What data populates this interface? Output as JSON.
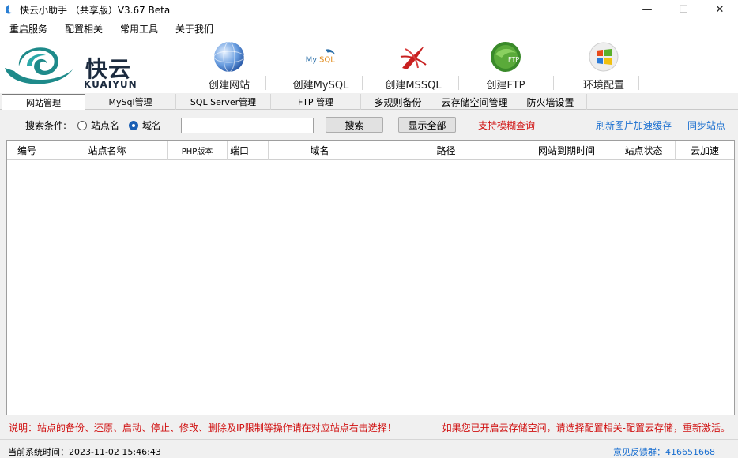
{
  "window": {
    "title": "快云小助手 （共享版）V3.67 Beta",
    "minimize_glyph": "—",
    "maximize_glyph": "☐",
    "close_glyph": "✕"
  },
  "menu": [
    "重启服务",
    "配置相关",
    "常用工具",
    "关于我们"
  ],
  "logo": {
    "cn": "快云",
    "en": "KUAIYUN"
  },
  "toolbar": [
    {
      "label": "创建网站",
      "icon": "globe-icon"
    },
    {
      "label": "创建MySQL",
      "icon": "mysql-icon"
    },
    {
      "label": "创建MSSQL",
      "icon": "mssql-icon"
    },
    {
      "label": "创建FTP",
      "icon": "ftp-icon"
    },
    {
      "label": "环境配置",
      "icon": "windows-icon"
    }
  ],
  "tabs": [
    "网站管理",
    "MySql管理",
    "SQL Server管理",
    "FTP 管理",
    "多规则备份",
    "云存储空间管理",
    "防火墙设置"
  ],
  "search": {
    "condition_label": "搜索条件:",
    "option_site": "站点名",
    "option_domain": "域名",
    "selected": "域名",
    "value": "",
    "search_button": "搜索",
    "show_all_button": "显示全部",
    "fuzzy_hint": "支持模糊查询",
    "refresh_link": "刷新图片加速缓存",
    "sync_link": "同步站点"
  },
  "table": {
    "columns": [
      "编号",
      "站点名称",
      "PHP版本",
      "端口",
      "域名",
      "路径",
      "网站到期时间",
      "站点状态",
      "云加速"
    ],
    "rows": []
  },
  "notes": {
    "left": "说明：站点的备份、还原、启动、停止、修改、删除及IP限制等操作请在对应站点右击选择！",
    "right": "如果您已开启云存储空间，请选择配置相关-配置云存储，重新激活。"
  },
  "status": {
    "time_label": "当前系统时间：",
    "time_value": "2023-11-02 15:46:43",
    "feedback_link": "意见反馈群：416651668"
  },
  "colors": {
    "accent": "#1a6fd0",
    "warning": "#d01010"
  }
}
